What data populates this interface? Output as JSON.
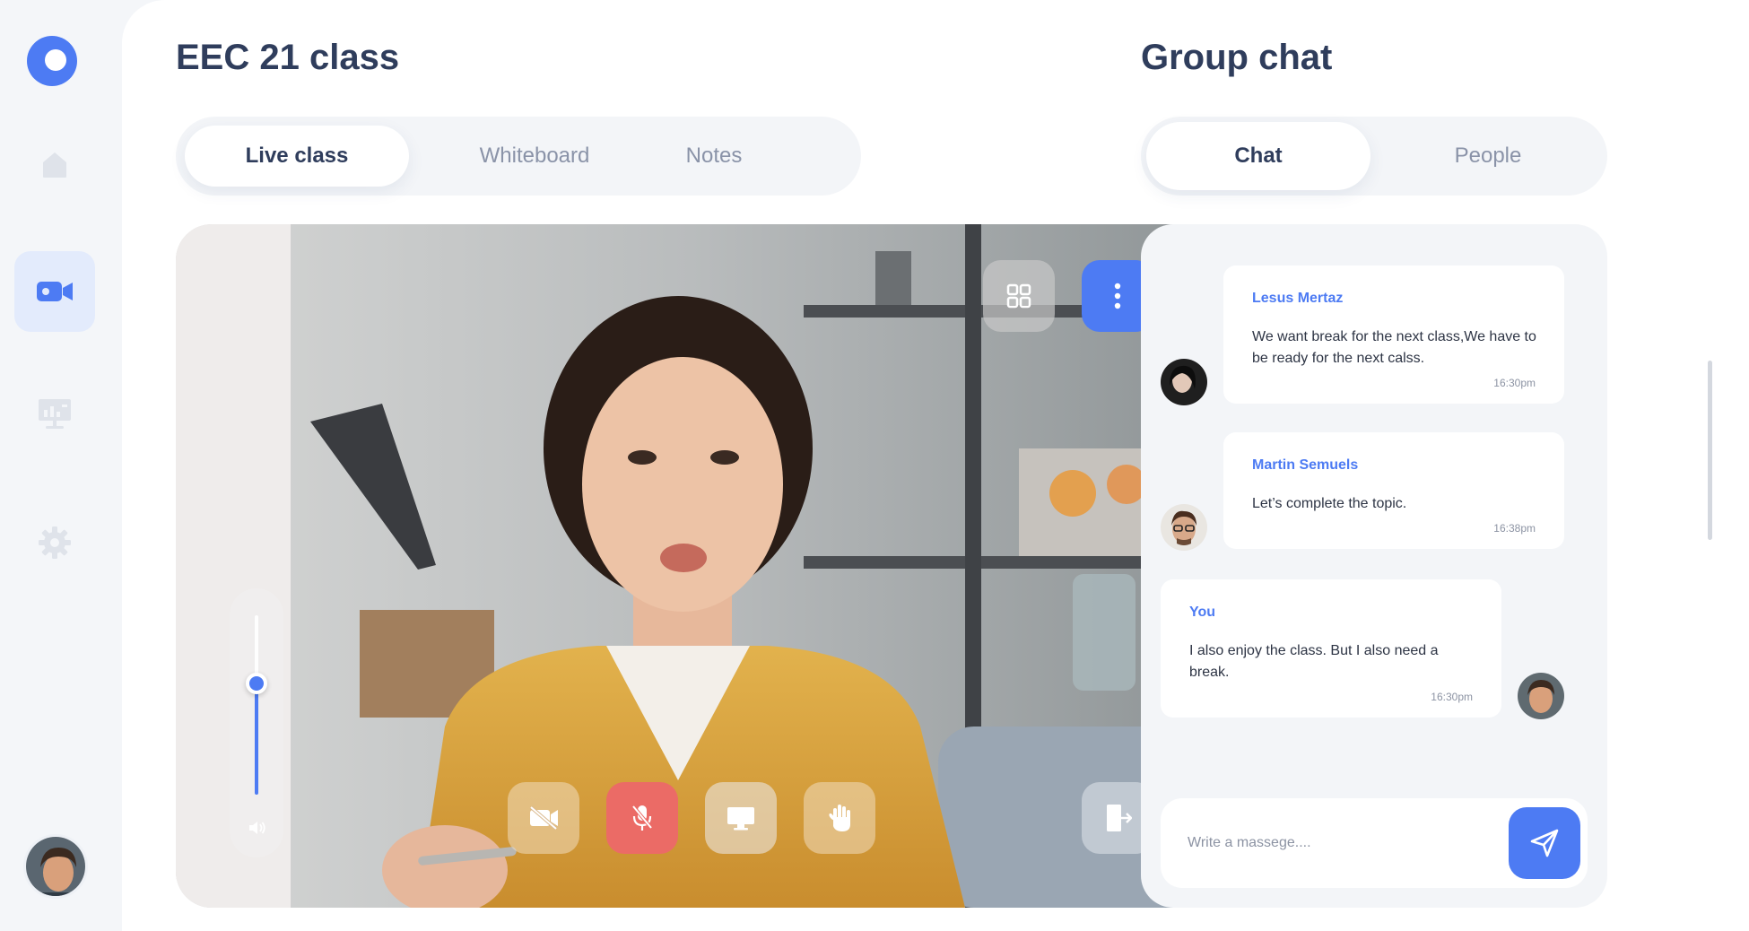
{
  "app": {
    "page_title": "EEC 21 class"
  },
  "colors": {
    "accent": "#4d7bf3",
    "mic_muted": "#eb6b66",
    "sidebar_bg": "#f4f6f9"
  },
  "sidebar": {
    "items": [
      {
        "icon": "home-icon",
        "active": false
      },
      {
        "icon": "video-camera-icon",
        "active": true
      },
      {
        "icon": "presentation-board-icon",
        "active": false
      },
      {
        "icon": "gear-icon",
        "active": false
      }
    ]
  },
  "tabs": {
    "live": "Live class",
    "whiteboard": "Whiteboard",
    "notes": "Notes",
    "active": "live"
  },
  "video": {
    "top_controls": [
      "grid-view-icon",
      "more-vertical-icon"
    ],
    "bottom_controls": [
      "camera-off-icon",
      "mic-muted-icon",
      "screen-share-icon",
      "raise-hand-icon"
    ],
    "leave_control": "leave-door-icon",
    "volume_level": 0.62
  },
  "chat": {
    "title": "Group chat",
    "tabs": {
      "chat": "Chat",
      "people": "People",
      "active": "chat"
    },
    "messages": [
      {
        "name": "Lesus Mertaz",
        "text": "We want break for the next class,We have to be ready for the next calss.",
        "time": "16:30pm"
      },
      {
        "name": "Martin Semuels",
        "text": "Let’s complete the topic.",
        "time": "16:38pm"
      },
      {
        "name": "You",
        "text": "I also enjoy the class. But I also need a break.",
        "time": "16:30pm"
      }
    ],
    "composer": {
      "placeholder": "Write a massege...."
    }
  }
}
